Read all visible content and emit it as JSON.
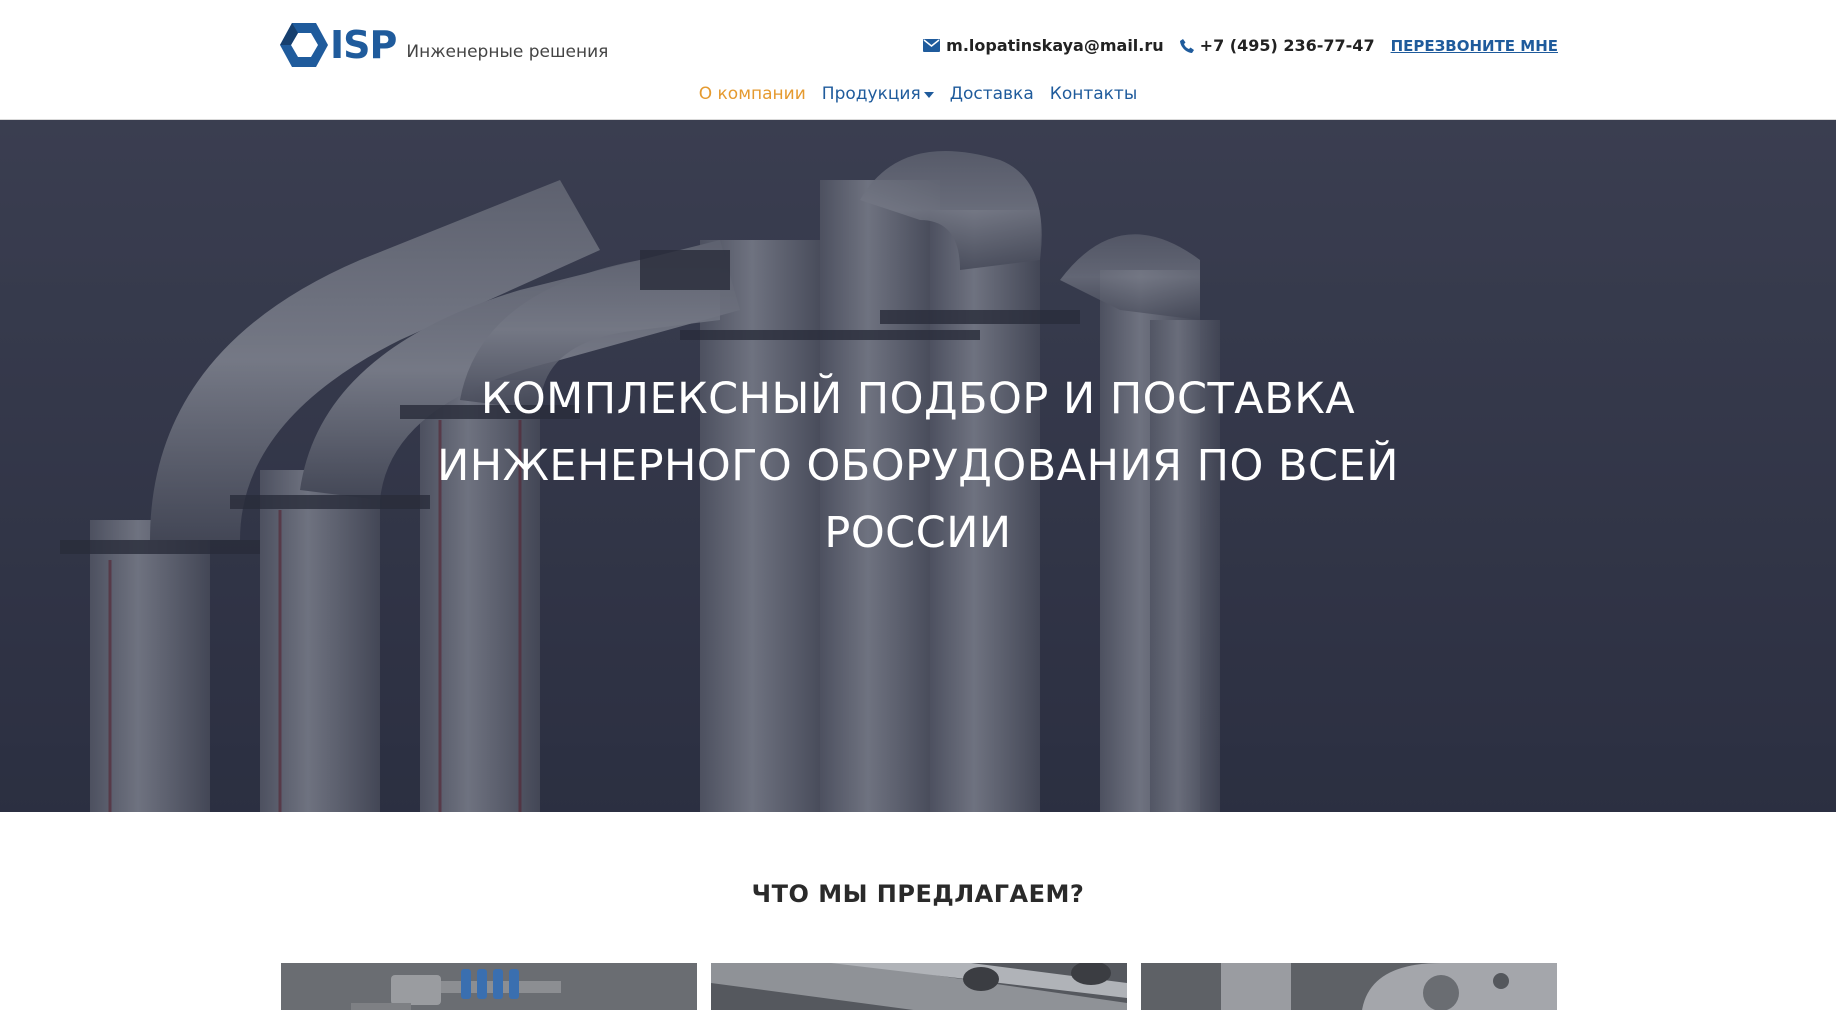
{
  "header": {
    "logo_text": "ISP",
    "tagline": "Инженерные решения",
    "email": "m.lopatinskaya@mail.ru",
    "phone": "+7 (495) 236-77-47",
    "callback_label": "ПЕРЕЗВОНИТЕ МНЕ"
  },
  "nav": {
    "items": [
      {
        "label": "О компании",
        "active": true
      },
      {
        "label": "Продукция",
        "has_dropdown": true
      },
      {
        "label": "Доставка"
      },
      {
        "label": "Контакты"
      }
    ]
  },
  "hero": {
    "title": "КОМПЛЕКСНЫЙ ПОДБОР И ПОСТАВКА ИНЖЕНЕРНОГО ОБОРУДОВАНИЯ ПО ВСЕЙ РОССИИ"
  },
  "offer": {
    "title": "ЧТО МЫ ПРЕДЛАГАЕМ?"
  },
  "colors": {
    "brand_blue": "#1f5b9c",
    "nav_active": "#e59a2f",
    "hero_overlay": "#282c40"
  },
  "icons": [
    "envelope-icon",
    "phone-icon",
    "caret-down-icon"
  ]
}
